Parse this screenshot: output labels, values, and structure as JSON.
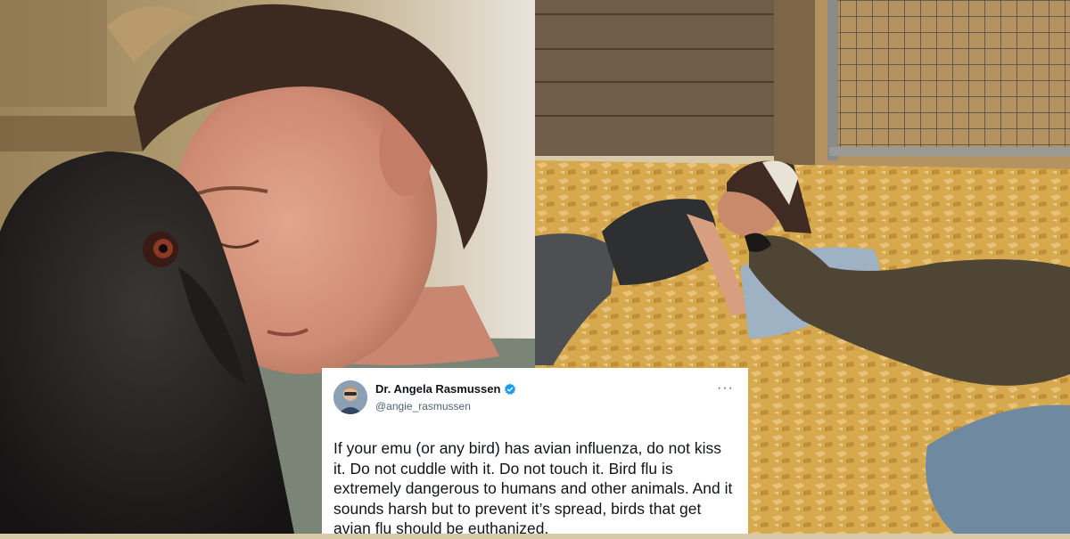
{
  "photos": {
    "left": {
      "icon": "emu-and-woman-photo"
    },
    "right": {
      "icon": "woman-kissing-emu-in-barn-photo"
    }
  },
  "tweet": {
    "display_name": "Dr. Angela Rasmussen",
    "handle": "@angie_rasmussen",
    "text": "If your emu (or any bird) has avian influenza, do not kiss it. Do not cuddle with it. Do not touch it. Bird flu is extremely dangerous to humans and other animals. And it sounds harsh but to prevent it’s spread, birds that get avian flu should be euthanized.",
    "more_label": "···",
    "colors": {
      "verified": "#1d9bf0",
      "name": "#0f1419",
      "handle": "#536471"
    }
  }
}
